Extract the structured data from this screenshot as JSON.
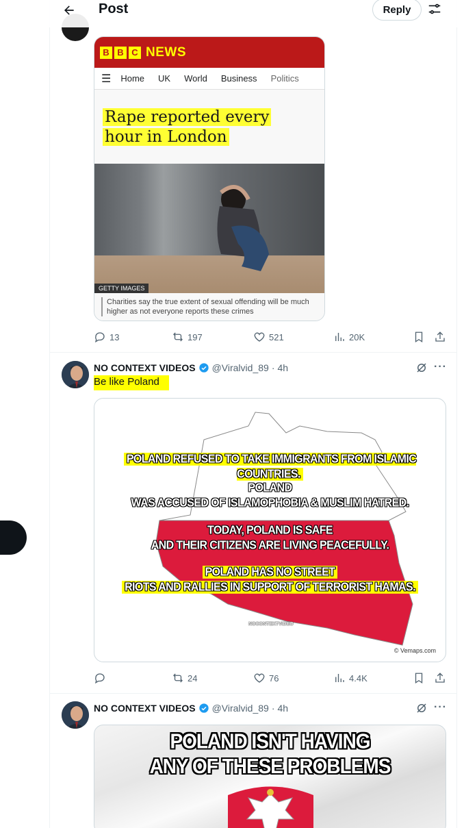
{
  "header": {
    "title": "Post",
    "reply_label": "Reply"
  },
  "quoted_media": {
    "brand": [
      "B",
      "B",
      "C"
    ],
    "brand_news": "NEWS",
    "nav": [
      "Home",
      "UK",
      "World",
      "Business",
      "Politics"
    ],
    "headline_line1": "Rape reported every",
    "headline_line2": "hour in London",
    "photo_credit": "GETTY IMAGES",
    "caption": "Charities say the true extent of sexual offending will be much higher as not everyone reports these crimes"
  },
  "post1_actions": {
    "replies": "13",
    "reposts": "197",
    "likes": "521",
    "views": "20K"
  },
  "post2": {
    "author_name": "NO CONTEXT VIDEOS",
    "handle": "@Viralvid_89",
    "separator": "·",
    "time": "4h",
    "text": "Be like Poland",
    "meme_line1": "POLAND REFUSED TO TAKE IMMIGRANTS FROM ISLAMIC COUNTRIES.",
    "meme_line2a": "POLAND",
    "meme_line2b": "WAS ACCUSED OF ISLAMOPHOBIA & MUSLIM HATRED.",
    "meme_line3a": "TODAY, POLAND IS SAFE",
    "meme_line3b": "AND THEIR CITIZENS ARE LIVING PEACEFULLY.",
    "meme_line4a": "POLAND HAS NO STREET",
    "meme_line4b": "RIOTS AND RALLIES IN SUPPORT OF TERRORIST HAMAS.",
    "watermark": "NOCONTEXTVIDEO",
    "map_credit": "© Vemaps.com",
    "actions": {
      "replies": "",
      "reposts": "24",
      "likes": "76",
      "views": "4.4K"
    }
  },
  "post3": {
    "author_name": "NO CONTEXT VIDEOS",
    "handle": "@Viralvid_89",
    "separator": "·",
    "time": "4h",
    "image_text_line1": "POLAND ISN'T HAVING",
    "image_text_line2": "ANY OF THESE PROBLEMS"
  },
  "colors": {
    "bbc_red": "#bb1919",
    "highlight": "#ffff00",
    "poland_red": "#dc143c",
    "verified_blue": "#1d9bf0",
    "muted_text": "#536471"
  }
}
